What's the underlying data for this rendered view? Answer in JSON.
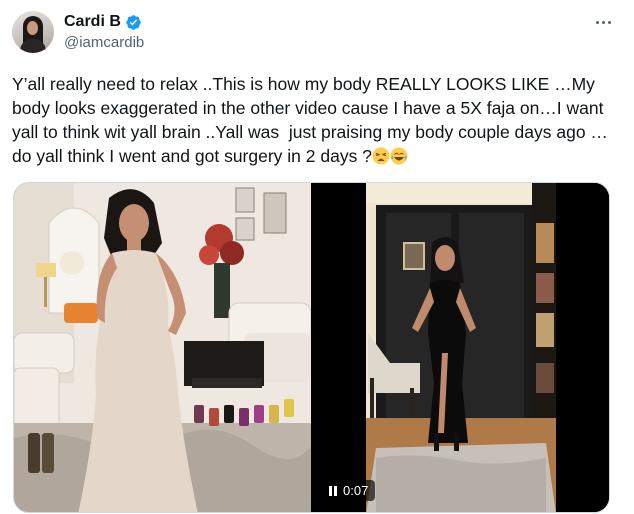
{
  "tweet": {
    "display_name": "Cardi B",
    "handle": "@iamcardib",
    "text": "Y’all really need to relax ..This is how my body REALLY LOOKS LIKE …My body looks exaggerated in the other video cause I have a 5X faja on…I want yall to think wit yall brain ..Yall was  just praising my body couple days ago …do yall think I went and got surgery in 2 days ?",
    "emojis": [
      "tired-face-emoji",
      "tears-of-joy-emoji"
    ],
    "verified": true
  },
  "media": {
    "video_time": "0:07",
    "left_image": "woman-in-beige-dress-living-room",
    "right_image": "woman-in-black-dress-hallway-video"
  },
  "icons": {
    "verified": "verified-badge-icon",
    "more": "more-options-icon",
    "pause": "pause-icon"
  },
  "colors": {
    "primary_text": "#0f1419",
    "secondary_text": "#536471",
    "verified_blue": "#1d9bf0",
    "border": "#cfd9de"
  }
}
